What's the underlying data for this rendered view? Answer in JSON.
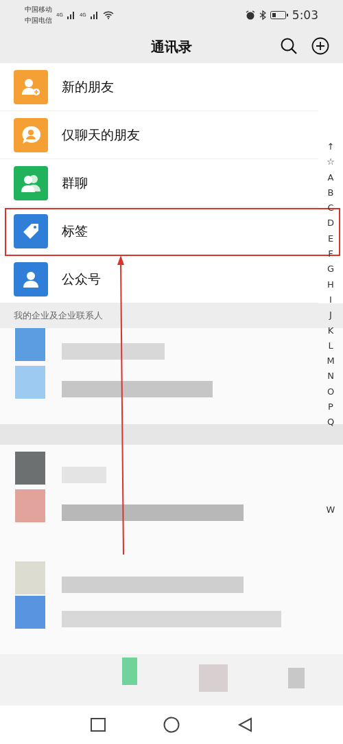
{
  "status_bar": {
    "carrier_1": "中国移动",
    "carrier_2": "中国电信",
    "network_1": "4G",
    "network_2": "4G",
    "time": "5:03"
  },
  "header": {
    "title": "通讯录"
  },
  "items": [
    {
      "label": "新的朋友",
      "kind": "person-add",
      "color": "#f5a035",
      "highlighted": false
    },
    {
      "label": "仅聊天的朋友",
      "kind": "chat",
      "color": "#f5a035",
      "highlighted": false
    },
    {
      "label": "群聊",
      "kind": "group",
      "color": "#21b35c",
      "highlighted": false
    },
    {
      "label": "标签",
      "kind": "tag",
      "color": "#2f7fd8",
      "highlighted": true
    },
    {
      "label": "公众号",
      "kind": "person",
      "color": "#2f7fd8",
      "highlighted": false
    }
  ],
  "section": {
    "title": "我的企业及企业联系人"
  },
  "index_top": [
    "↑",
    "☆",
    "A",
    "B",
    "C",
    "D",
    "E",
    "F",
    "G",
    "H",
    "I",
    "J",
    "K",
    "L",
    "M",
    "N",
    "O",
    "P",
    "Q"
  ],
  "index_bottom": [
    "W"
  ]
}
